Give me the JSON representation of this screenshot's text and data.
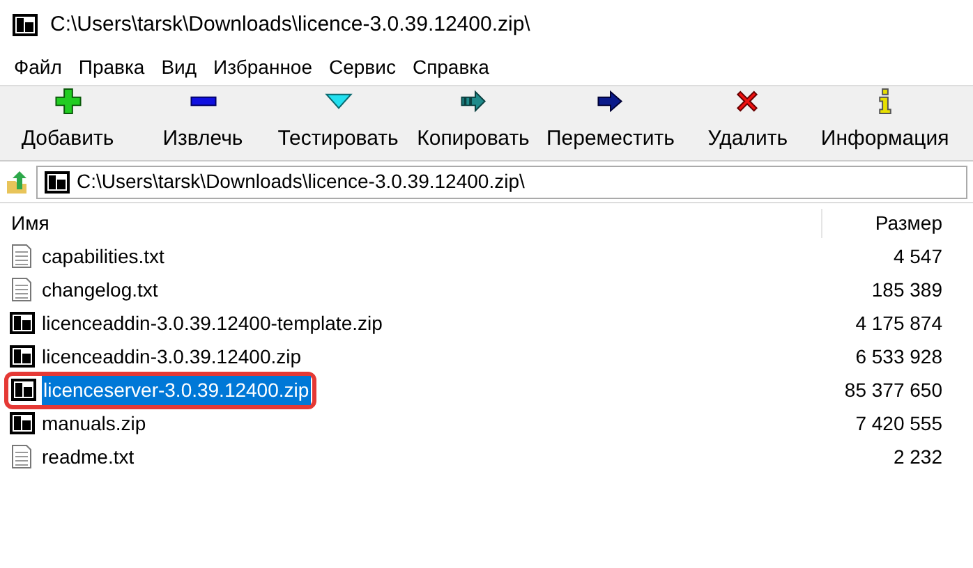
{
  "window": {
    "title": "C:\\Users\\tarsk\\Downloads\\licence-3.0.39.12400.zip\\"
  },
  "menu": [
    "Файл",
    "Правка",
    "Вид",
    "Избранное",
    "Сервис",
    "Справка"
  ],
  "toolbar": [
    {
      "kind": "add",
      "label": "Добавить"
    },
    {
      "kind": "extract",
      "label": "Извлечь"
    },
    {
      "kind": "test",
      "label": "Тестировать"
    },
    {
      "kind": "copy",
      "label": "Копировать"
    },
    {
      "kind": "move",
      "label": "Переместить"
    },
    {
      "kind": "delete",
      "label": "Удалить"
    },
    {
      "kind": "info",
      "label": "Информация"
    }
  ],
  "address": {
    "value": "C:\\Users\\tarsk\\Downloads\\licence-3.0.39.12400.zip\\"
  },
  "table": {
    "columns": [
      "Имя",
      "Размер"
    ],
    "rows": [
      {
        "kind": "text",
        "name": "capabilities.txt",
        "size": "4 547",
        "selected": false,
        "annotated": false
      },
      {
        "kind": "text",
        "name": "changelog.txt",
        "size": "185 389",
        "selected": false,
        "annotated": false
      },
      {
        "kind": "archive",
        "name": "licenceaddin-3.0.39.12400-template.zip",
        "size": "4 175 874",
        "selected": false,
        "annotated": false
      },
      {
        "kind": "archive",
        "name": "licenceaddin-3.0.39.12400.zip",
        "size": "6 533 928",
        "selected": false,
        "annotated": false
      },
      {
        "kind": "archive",
        "name": "licenceserver-3.0.39.12400.zip",
        "size": "85 377 650",
        "selected": true,
        "annotated": true
      },
      {
        "kind": "archive",
        "name": "manuals.zip",
        "size": "7 420 555",
        "selected": false,
        "annotated": false
      },
      {
        "kind": "text",
        "name": "readme.txt",
        "size": "2 232",
        "selected": false,
        "annotated": false
      }
    ]
  }
}
